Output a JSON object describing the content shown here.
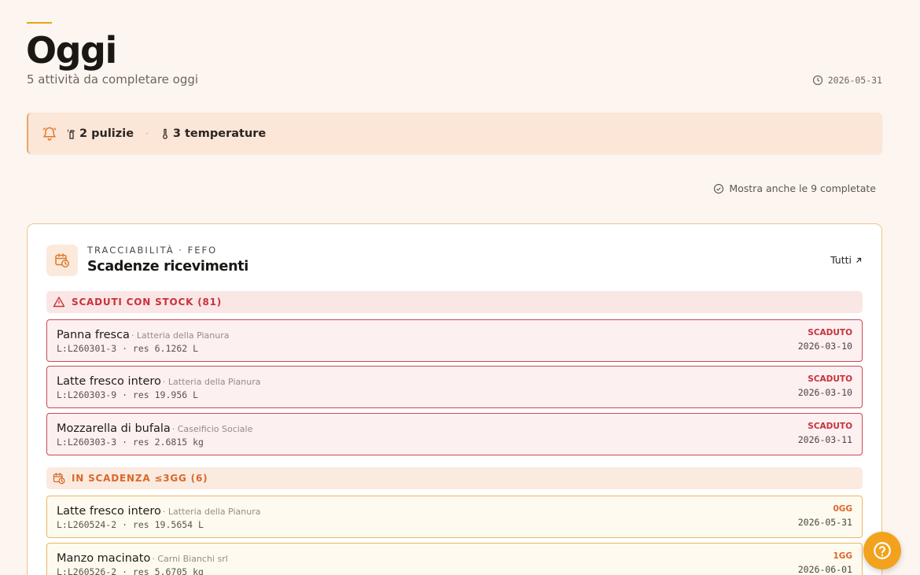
{
  "header": {
    "title": "Oggi",
    "subtitle": "5 attività da completare oggi",
    "date": "2026-05-31",
    "date_icon": "clock-icon"
  },
  "alerts": {
    "bell_icon": "bell-icon",
    "cleaning_label": "2 pulizie",
    "cleaning_icon": "spray-bottle-icon",
    "separator": "·",
    "temperature_label": "3 temperature",
    "temperature_icon": "thermometer-icon"
  },
  "show_completed": {
    "label": "Mostra anche le 9 completate",
    "icon": "check-circle-icon"
  },
  "card": {
    "icon": "calendar-clock-icon",
    "eyebrow": "TRACCIABILITÀ · FEFO",
    "title": "Scadenze ricevimenti",
    "all_link": "Tutti",
    "all_link_icon": "arrow-up-right-icon",
    "sections": [
      {
        "title": "SCADUTI CON STOCK (81)",
        "icon": "warning-triangle-icon",
        "color": "#c6333a",
        "rows": [
          {
            "product": "Panna fresca",
            "supplier": "· Latteria della Pianura",
            "detail": "L:L260301-3 · res 6.1262 L",
            "status": "SCADUTO",
            "date": "2026-03-10"
          },
          {
            "product": "Latte fresco intero",
            "supplier": "· Latteria della Pianura",
            "detail": "L:L260303-9 · res 19.956 L",
            "status": "SCADUTO",
            "date": "2026-03-10"
          },
          {
            "product": "Mozzarella di bufala",
            "supplier": "· Caseificio Sociale",
            "detail": "L:L260303-3 · res 2.6815 kg",
            "status": "SCADUTO",
            "date": "2026-03-11"
          }
        ]
      },
      {
        "title": "IN SCADENZA ≤3GG (6)",
        "icon": "calendar-clock-icon",
        "color": "#d9682b",
        "rows": [
          {
            "product": "Latte fresco intero",
            "supplier": "· Latteria della Pianura",
            "detail": "L:L260524-2 · res 19.5654 L",
            "status": "0GG",
            "date": "2026-05-31"
          },
          {
            "product": "Manzo macinato",
            "supplier": "· Carni Bianchi srl",
            "detail": "L:L260526-2 · res 5.6705 kg",
            "status": "1GG",
            "date": "2026-06-01"
          }
        ]
      }
    ]
  },
  "help_button": {
    "icon": "help-circle-icon"
  }
}
